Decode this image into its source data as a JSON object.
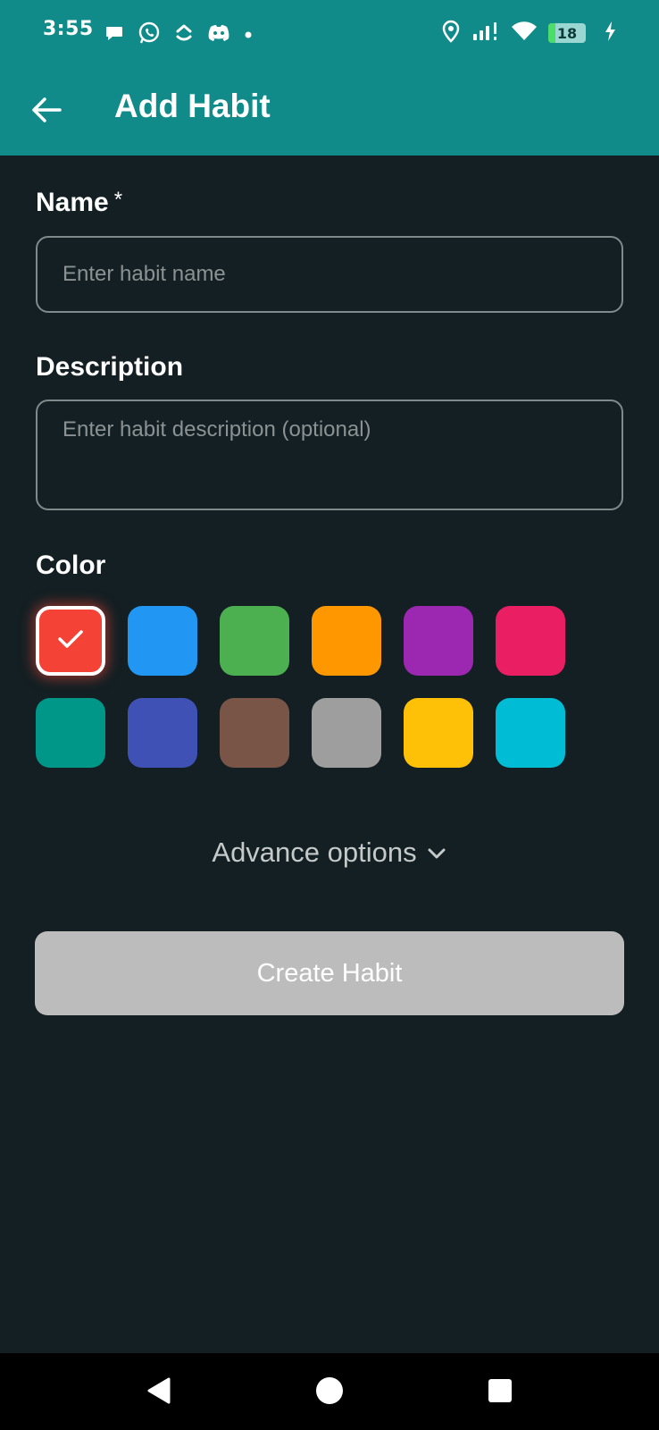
{
  "status_bar": {
    "time": "3:55",
    "battery_level": "18",
    "battery_percent": 18,
    "notification_icons": [
      "chat-bubble-icon",
      "whatsapp-icon",
      "clickup-icon",
      "discord-icon",
      "dot-icon"
    ],
    "system_icons": [
      "location-icon",
      "signal-icon",
      "wifi-icon",
      "battery-icon",
      "charging-icon"
    ]
  },
  "app_bar": {
    "title": "Add Habit",
    "back_icon": "arrow-left-icon",
    "background": "#118b8a"
  },
  "form": {
    "name": {
      "label": "Name",
      "required_mark": "*",
      "value": "",
      "placeholder": "Enter habit name"
    },
    "description": {
      "label": "Description",
      "value": "",
      "placeholder": "Enter habit description (optional)"
    },
    "color": {
      "label": "Color",
      "selected_index": 0,
      "options": [
        "#f44336",
        "#2196f3",
        "#4caf50",
        "#ff9800",
        "#9c27b0",
        "#e91e63",
        "#009688",
        "#3f51b5",
        "#795548",
        "#9e9e9e",
        "#ffc107",
        "#00bcd4"
      ]
    },
    "advance_options_label": "Advance options",
    "submit_label": "Create Habit"
  },
  "nav_bar": {
    "icons": [
      "back-triangle-icon",
      "home-circle-icon",
      "recents-square-icon"
    ]
  }
}
